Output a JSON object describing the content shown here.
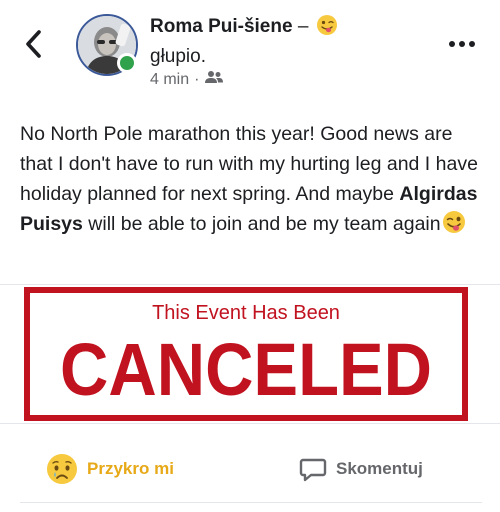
{
  "header": {
    "back_icon": "chevron-left-icon",
    "author_name": "Roma Pui-šiene",
    "feeling_separator": " – ",
    "feeling_emoji_icon": "grinning-face-with-tongue-icon",
    "feeling_text": "głupio.",
    "time_ago": "4 min",
    "time_separator": "·",
    "audience_icon": "friends-audience-icon",
    "more_icon": "more-horizontal-icon",
    "online_status_color": "#31a24c"
  },
  "post": {
    "text_before_mention": "No North Pole marathon this year! Good news are that I don't have to run with my hurting leg and I have holiday planned for next spring. And maybe ",
    "mention": "Algirdas Puisys",
    "text_after_mention": " will be able to join and be my team again",
    "trailing_emoji_icon": "winking-face-with-tongue-icon"
  },
  "image": {
    "line1": "This Event Has Been",
    "line2": "CANCELED",
    "stamp_color": "#c1121f"
  },
  "actions": {
    "reaction_icon": "sad-face-icon",
    "reaction_label": "Przykro mi",
    "reaction_color": "#e7a918",
    "comment_icon": "comment-bubble-icon",
    "comment_label": "Skomentuj"
  }
}
